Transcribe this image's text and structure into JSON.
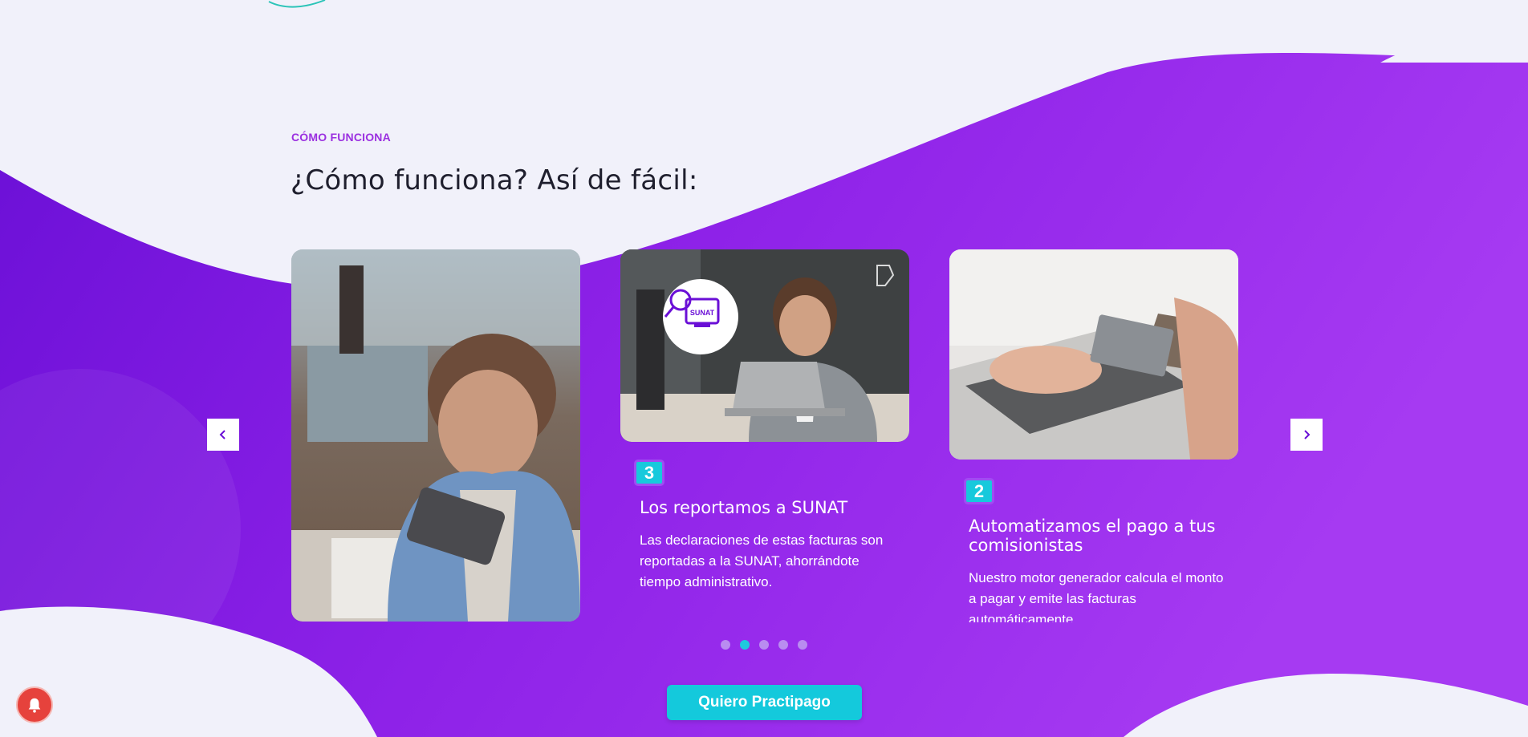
{
  "section": {
    "eyebrow": "CÓMO FUNCIONA",
    "heading": "¿Cómo funciona? Así de fácil:"
  },
  "carousel": {
    "cards": [
      {
        "image": "man-with-tablet-photo"
      },
      {
        "number": "3",
        "title": "Los reportamos a SUNAT",
        "text": "Las declaraciones de estas facturas son reportadas a la SUNAT, ahorrándote tiempo administrativo.",
        "image": "smiling-man-laptop-photo",
        "image_badge": "SUNAT"
      },
      {
        "number": "2",
        "title": "Automatizamos el pago a tus comisionistas",
        "text": "Nuestro motor generador calcula el monto a pagar y emite las facturas automáticamente.",
        "image": "credit-card-laptop-photo"
      }
    ],
    "prev_icon": "chevron-left-icon",
    "next_icon": "chevron-right-icon",
    "dots": 5,
    "active_dot": 2
  },
  "cta": {
    "label": "Quiero Practipago"
  },
  "notification": {
    "icon": "bell-icon"
  },
  "colors": {
    "accent": "#9b30e0",
    "cta": "#14c9dc",
    "purple_dark": "#6a0fd6",
    "purple_light": "#a63af2"
  }
}
